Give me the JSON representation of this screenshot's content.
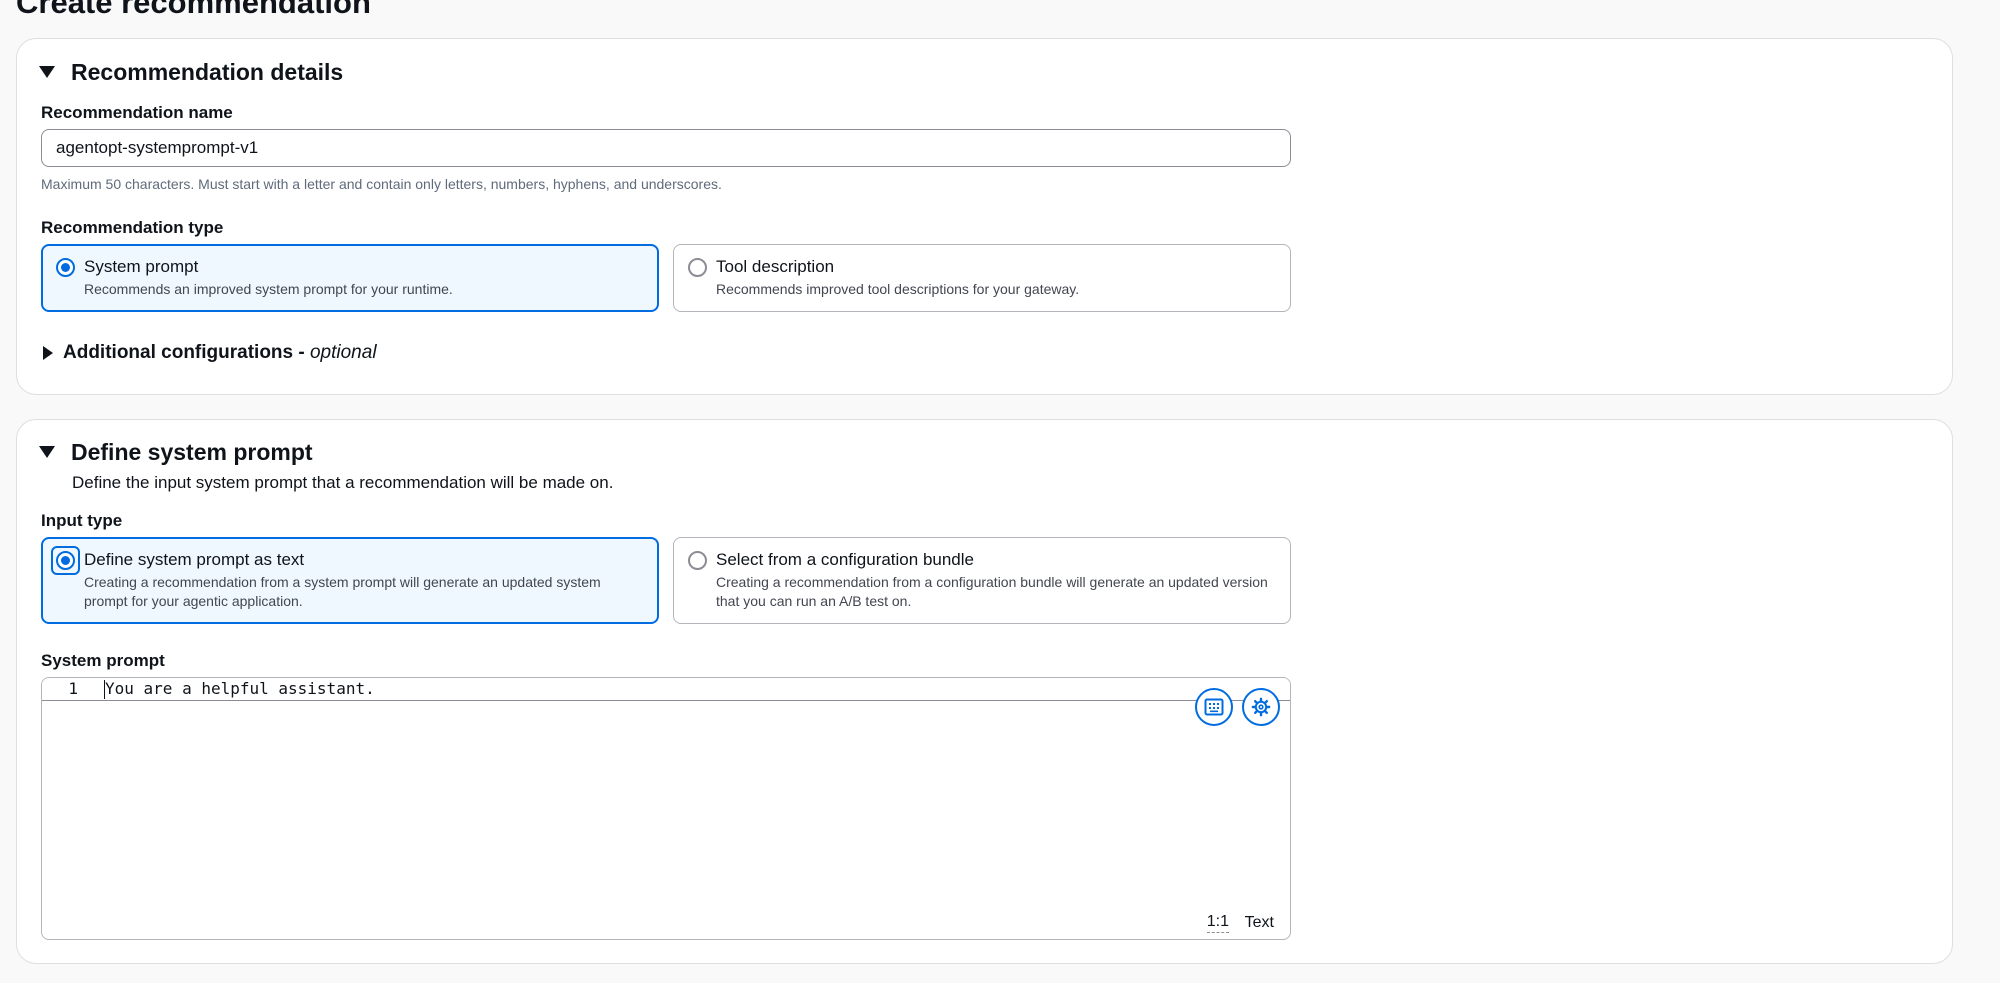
{
  "page": {
    "title": "Create recommendation"
  },
  "details": {
    "title": "Recommendation details",
    "name_label": "Recommendation name",
    "name_value": "agentopt-systemprompt-v1",
    "name_hint": "Maximum 50 characters. Must start with a letter and contain only letters, numbers, hyphens, and underscores.",
    "type_label": "Recommendation type",
    "types": [
      {
        "title": "System prompt",
        "desc": "Recommends an improved system prompt for your runtime.",
        "selected": true
      },
      {
        "title": "Tool description",
        "desc": "Recommends improved tool descriptions for your gateway.",
        "selected": false
      }
    ],
    "additional_label": "Additional configurations - ",
    "additional_optional": "optional"
  },
  "define": {
    "title": "Define system prompt",
    "description": "Define the input system prompt that a recommendation will be made on.",
    "input_type_label": "Input type",
    "input_types": [
      {
        "title": "Define system prompt as text",
        "desc": "Creating a recommendation from a system prompt will generate an updated system prompt for your agentic application.",
        "selected": true
      },
      {
        "title": "Select from a configuration bundle",
        "desc": "Creating a recommendation from a configuration bundle will generate an updated version that you can run an A/B test on.",
        "selected": false
      }
    ],
    "prompt_label": "System prompt",
    "editor": {
      "line_number": "1",
      "code": "You are a helpful assistant.",
      "cursor_position": "1:1",
      "language": "Text",
      "icons": [
        "keyboard-icon",
        "gear-icon"
      ]
    }
  },
  "colors": {
    "accent": "#006ce0",
    "selected_bg": "#f0f8ff",
    "border": "#b4b4bb"
  }
}
